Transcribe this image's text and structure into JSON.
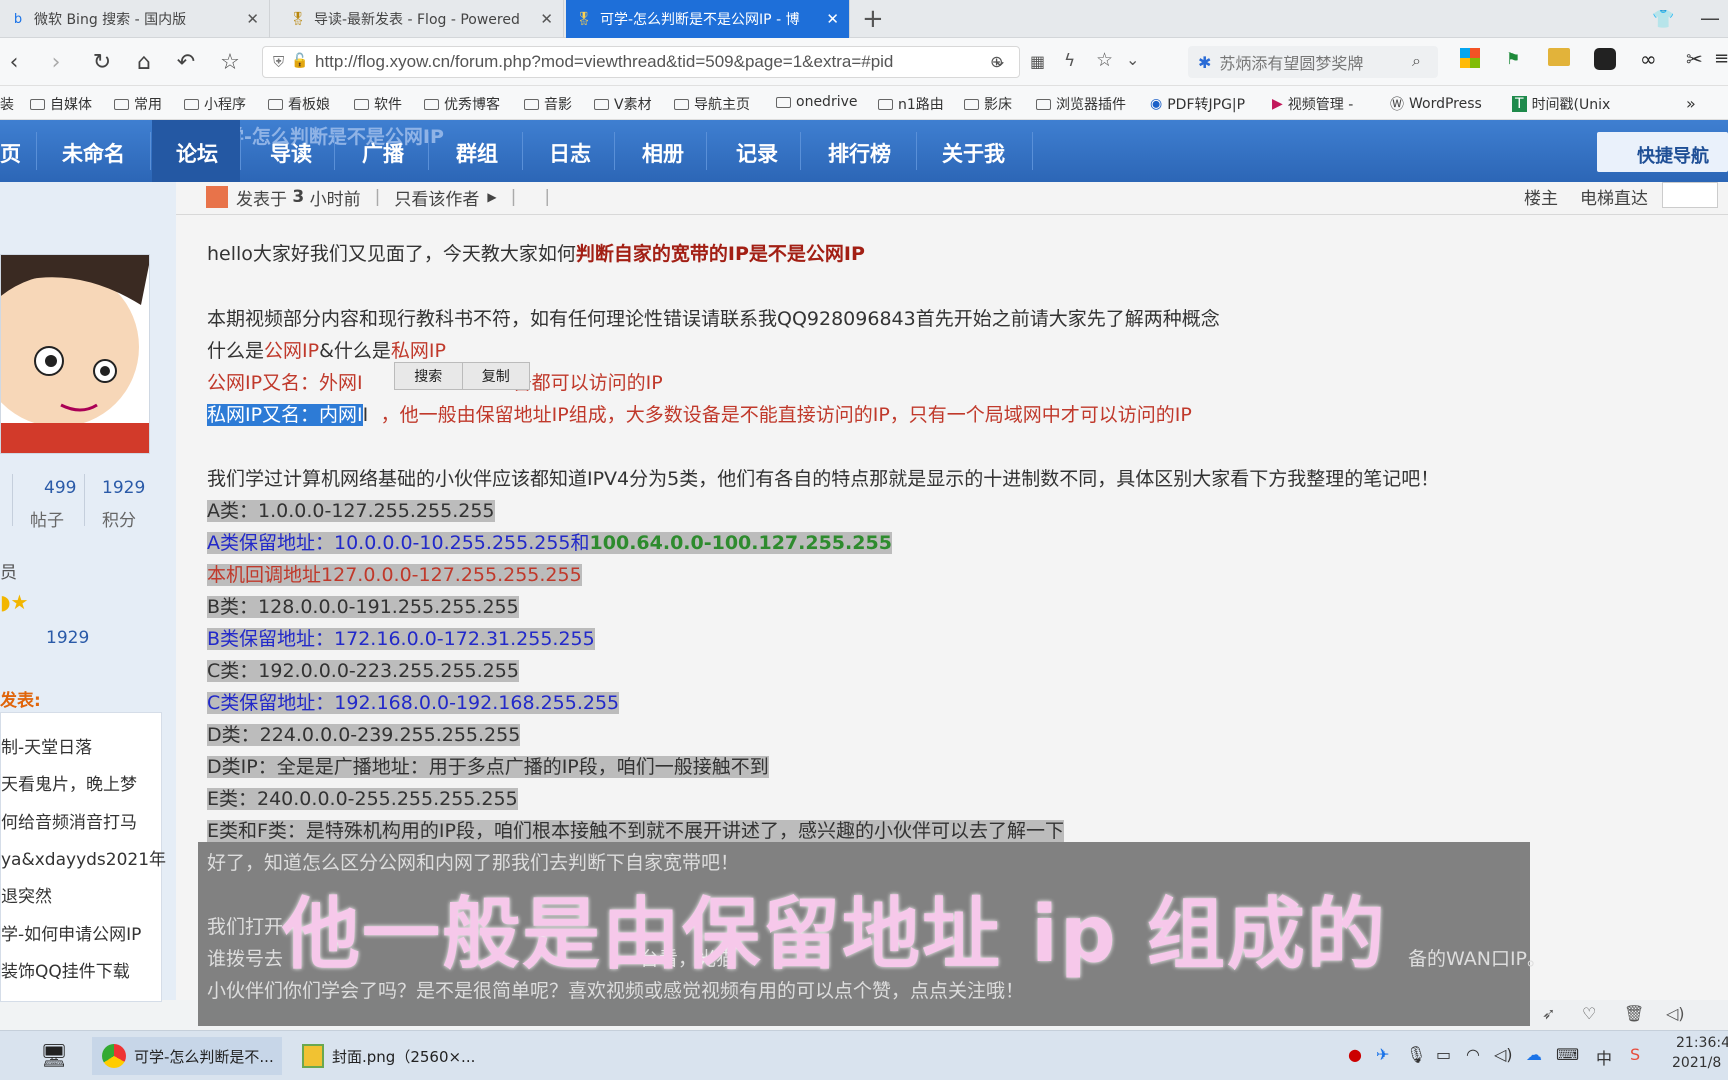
{
  "tabs": [
    {
      "icon": "bing-icon",
      "label": "微软 Bing 搜索 - 国内版"
    },
    {
      "icon": "medal-icon",
      "label": "导读-最新发表 - Flog - Powered"
    },
    {
      "icon": "medal-icon",
      "label": "可学-怎么判断是不是公网IP - 博"
    }
  ],
  "address": {
    "url": "http://flog.xyow.cn/forum.php?mod=viewthread&tid=509&page=1&extra=#pid",
    "search_placeholder": "苏炳添有望圆梦奖牌"
  },
  "bookmarks": [
    "自媒体",
    "常用",
    "小程序",
    "看板娘",
    "软件",
    "优秀博客",
    "音影",
    "V素材",
    "导航主页",
    "onedrive",
    "n1路由",
    "影床",
    "浏览器插件",
    "PDF转JPG|P",
    "视频管理 -",
    "WordPress",
    "时间戳(Unix"
  ],
  "bookmarks_left_fragment": "装",
  "site_nav": {
    "items": [
      "页",
      "未命名",
      "论坛",
      "导读",
      "广播",
      "群组",
      "日志",
      "相册",
      "记录",
      "排行榜",
      "关于我"
    ],
    "active": "论坛",
    "quick_nav": "快捷导航",
    "behind_title": "可学-怎么判断是不是公网IP"
  },
  "left": {
    "stats": [
      {
        "value": "499",
        "label": "帖子"
      },
      {
        "value": "1929",
        "label": "积分"
      }
    ],
    "role_fragment": "员",
    "score": "1929",
    "section_title": "发表:",
    "posts": [
      "制-天堂日落",
      "天看鬼片，晚上梦",
      "何给音频消音打马",
      "ya&xdayyds2021年",
      "退突然",
      "学-如何申请公网IP",
      "装饰QQ挂件下载"
    ]
  },
  "post_meta": {
    "posted": "发表于",
    "time_num": "3",
    "time_unit": "小时前",
    "only_author": "只看该作者",
    "floor": "楼主",
    "elevator": "电梯直达"
  },
  "post": {
    "l1_a": "hello大家好我们又见面了，今天教大家如何",
    "l1_b": "判断自家的宽带的IP是不是公网IP",
    "l2": "本期视频部分内容和现行教科书不符，如有任何理论性错误请联系我QQ928096843首先开始之前请大家先了解两种概念",
    "l3_a": "什么是",
    "l3_b": "公网IP",
    "l3_c": "&什么是",
    "l3_d": "私网IP",
    "l4_a": "公网IP又名：外网I",
    "l4_b": "备都可以访问的IP",
    "l5_sel": "私网IP又名：内网I",
    "l5_b": "，他一般由保留地址IP组成，大多数设备是不能直接访问的IP，只有一个局域网中才可以访问的IP",
    "l6": "我们学过计算机网络基础的小伙伴应该都知道IPV4分为5类，他们有各自的特点那就是显示的十进制数不同，具体区别大家看下方我整理的笔记吧！",
    "a_class": "A类：1.0.0.0-127.255.255.255",
    "a_res_label": "A类保留地址：",
    "a_res_1": "10.0.0.0-10.255.255.255",
    "a_res_and": "和",
    "a_res_2": "100.64.0.0-100.127.255.255",
    "loopback_label": "本机回调地址",
    "loopback": "127.0.0.0-127.255.255.255",
    "b_class": "B类：128.0.0.0-191.255.255.255",
    "b_res_label": "B类保留地址：",
    "b_res": "172.16.0.0-172.31.255.255",
    "c_class": "C类：192.0.0.0-223.255.255.255",
    "c_res_label": "C类保留地址：",
    "c_res": "192.168.0.0-192.168.255.255",
    "d_class": "D类：224.0.0.0-239.255.255.255",
    "d_ip": "D类IP：全是是广播地址：用于多点广播的IP段，咱们一般接触不到",
    "e_class": "E类：240.0.0.0-255.255.255.255",
    "ef": "E类和F类：是特殊机构用的IP段，咱们根本接触不到就不展开讲述了，感兴趣的小伙伴可以去了解一下",
    "l_good": "好了，知道怎么区分公网和内网了那我们去判断下自家宽带吧！",
    "l_open": "我们打开",
    "l_dial": "谁拨号去",
    "l_dial_mid": "台看，光猫",
    "l_dial_end": "备的WAN口IP。",
    "l_last": "小伙伴们你们学会了吗？是不是很简单呢？喜欢视频或感觉视频有用的可以点个赞，点点关注哦！"
  },
  "context_menu": {
    "search": "搜索",
    "copy": "复制"
  },
  "subtitle": "他一般是由保留地址 ip 组成的",
  "taskbar": {
    "app1": "可学-怎么判断是不...",
    "app2": "封面.png（2560×...",
    "time": "21:36:4",
    "date": "2021/8",
    "ime": "中"
  },
  "colors": {
    "accent": "#2c66b6",
    "active_tab": "#1e6fd9",
    "subtitle": "#f6c8ea"
  }
}
